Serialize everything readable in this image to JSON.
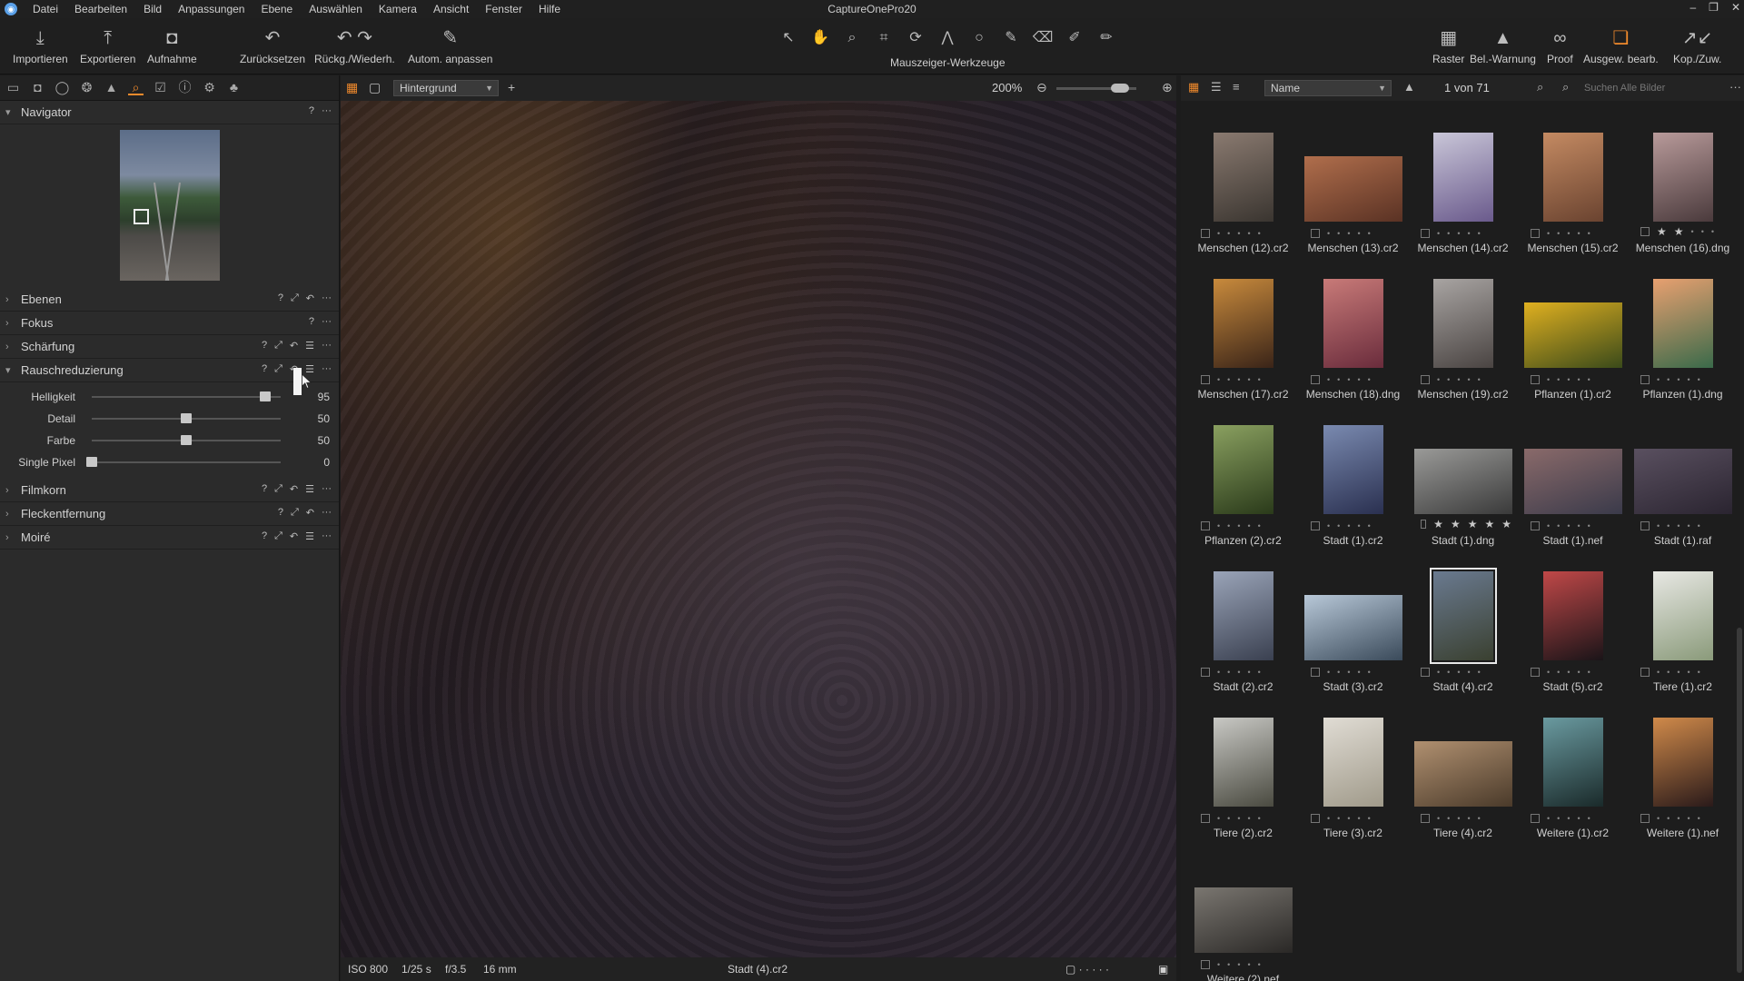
{
  "app": {
    "title": "CaptureOnePro20",
    "menu": [
      "Datei",
      "Bearbeiten",
      "Bild",
      "Anpassungen",
      "Ebene",
      "Auswählen",
      "Kamera",
      "Ansicht",
      "Fenster",
      "Hilfe"
    ],
    "window_controls": [
      "–",
      "❐",
      "✕"
    ]
  },
  "toolbar": {
    "left_buttons": [
      {
        "label": "Importieren",
        "icon": "import-icon"
      },
      {
        "label": "Exportieren",
        "icon": "export-icon"
      },
      {
        "label": "Aufnahme",
        "icon": "camera-icon"
      },
      {
        "label": "Zurücksetzen",
        "icon": "reset-icon"
      },
      {
        "label": "Rückg./Wiederh.",
        "icon": "undo-redo-icon"
      },
      {
        "label": "Autom. anpassen",
        "icon": "auto-adjust-icon"
      }
    ],
    "cursor_tools_label": "Mauszeiger-Werkzeuge",
    "right_buttons": [
      {
        "label": "Raster",
        "icon": "grid-icon"
      },
      {
        "label": "Bel.-Warnung",
        "icon": "exposure-warning-icon"
      },
      {
        "label": "Proof",
        "icon": "proof-glasses-icon"
      },
      {
        "label": "Ausgew. bearb.",
        "icon": "edit-selected-icon"
      },
      {
        "label": "Kop./Zuw.",
        "icon": "copy-apply-icon"
      }
    ]
  },
  "left_panel": {
    "tools": {
      "navigator": "Navigator",
      "ebenen": "Ebenen",
      "fokus": "Fokus",
      "schaerfung": "Schärfung",
      "rauschreduzierung": "Rauschreduzierung",
      "filmkorn": "Filmkorn",
      "fleckentfernung": "Fleckentfernung",
      "moire": "Moiré"
    },
    "noise_sliders": [
      {
        "label": "Helligkeit",
        "value": "95",
        "level": 0.92
      },
      {
        "label": "Detail",
        "value": "50",
        "level": 0.5
      },
      {
        "label": "Farbe",
        "value": "50",
        "level": 0.5
      },
      {
        "label": "Single Pixel",
        "value": "0",
        "level": 0.0
      }
    ]
  },
  "viewer": {
    "layer_select": "Hintergrund",
    "zoom": "200%",
    "status": {
      "iso": "ISO 800",
      "shutter": "1/25 s",
      "aperture": "f/3.5",
      "focal": "16 mm",
      "filename": "Stadt (4).cr2"
    }
  },
  "browser": {
    "sort": "Name",
    "count": "1 von 71",
    "search_placeholder": "Suchen Alle Bilder",
    "items": [
      {
        "name": "Menschen (12).cr2",
        "stars": 0,
        "c1": "#8a7a70",
        "c2": "#3a3530",
        "orient": "p"
      },
      {
        "name": "Menschen (13).cr2",
        "stars": 0,
        "c1": "#b06e4c",
        "c2": "#5a3224",
        "orient": "l"
      },
      {
        "name": "Menschen (14).cr2",
        "stars": 0,
        "c1": "#c9c6d8",
        "c2": "#6a5a8c",
        "orient": "p"
      },
      {
        "name": "Menschen (15).cr2",
        "stars": 0,
        "c1": "#c48a62",
        "c2": "#6a4330",
        "orient": "p"
      },
      {
        "name": "Menschen (16).dng",
        "stars": 2,
        "c1": "#b89a9a",
        "c2": "#4a3a3c",
        "orient": "p"
      },
      {
        "name": "Menschen (17).cr2",
        "stars": 0,
        "c1": "#c88a3c",
        "c2": "#3a2418",
        "orient": "p"
      },
      {
        "name": "Menschen (18).dng",
        "stars": 0,
        "c1": "#c87a78",
        "c2": "#6a2c3c",
        "orient": "p"
      },
      {
        "name": "Menschen (19).cr2",
        "stars": 0,
        "c1": "#a8a4a2",
        "c2": "#4a4442",
        "orient": "p"
      },
      {
        "name": "Pflanzen (1).cr2",
        "stars": 0,
        "c1": "#e0b020",
        "c2": "#3a4a1a",
        "orient": "l"
      },
      {
        "name": "Pflanzen (1).dng",
        "stars": 0,
        "c1": "#e8a070",
        "c2": "#3a6a4a",
        "orient": "p"
      },
      {
        "name": "Pflanzen (2).cr2",
        "stars": 0,
        "c1": "#8aa060",
        "c2": "#2a3a1a",
        "orient": "p"
      },
      {
        "name": "Stadt (1).cr2",
        "stars": 0,
        "c1": "#7a8ab0",
        "c2": "#2a3050",
        "orient": "p"
      },
      {
        "name": "Stadt (1).dng",
        "stars": 5,
        "c1": "#9a9a98",
        "c2": "#3a3a3a",
        "orient": "l"
      },
      {
        "name": "Stadt (1).nef",
        "stars": 0,
        "c1": "#8a6a6a",
        "c2": "#3a3a4a",
        "orient": "l"
      },
      {
        "name": "Stadt (1).raf",
        "stars": 0,
        "c1": "#5a5060",
        "c2": "#2a2430",
        "orient": "l"
      },
      {
        "name": "Stadt (2).cr2",
        "stars": 0,
        "c1": "#9aa4b8",
        "c2": "#3a4050",
        "orient": "p"
      },
      {
        "name": "Stadt (3).cr2",
        "stars": 0,
        "c1": "#b8c8d8",
        "c2": "#3a4a5a",
        "orient": "l"
      },
      {
        "name": "Stadt (4).cr2",
        "stars": 0,
        "c1": "#6a7a90",
        "c2": "#3a4030",
        "orient": "p",
        "selected": true
      },
      {
        "name": "Stadt (5).cr2",
        "stars": 0,
        "c1": "#c04848",
        "c2": "#1a1418",
        "orient": "p"
      },
      {
        "name": "Tiere (1).cr2",
        "stars": 0,
        "c1": "#e8e8e4",
        "c2": "#8a9a7a",
        "orient": "p"
      },
      {
        "name": "Tiere (2).cr2",
        "stars": 0,
        "c1": "#c8c8c4",
        "c2": "#4a4a40",
        "orient": "p"
      },
      {
        "name": "Tiere (3).cr2",
        "stars": 0,
        "c1": "#e0dcd4",
        "c2": "#a09a8a",
        "orient": "p"
      },
      {
        "name": "Tiere (4).cr2",
        "stars": 0,
        "c1": "#b09070",
        "c2": "#4a3a2a",
        "orient": "l"
      },
      {
        "name": "Weitere (1).cr2",
        "stars": 0,
        "c1": "#6a9aa0",
        "c2": "#1a2a2a",
        "orient": "p"
      },
      {
        "name": "Weitere (1).nef",
        "stars": 0,
        "c1": "#d08a4a",
        "c2": "#2a1a1a",
        "orient": "p"
      },
      {
        "name": "Weitere (2).nef",
        "stars": 0,
        "c1": "#7a7670",
        "c2": "#2a2826",
        "orient": "l"
      }
    ]
  },
  "colors": {
    "accent": "#f08a2c",
    "panel": "#2b2b2b",
    "background": "#1c1c1c"
  }
}
